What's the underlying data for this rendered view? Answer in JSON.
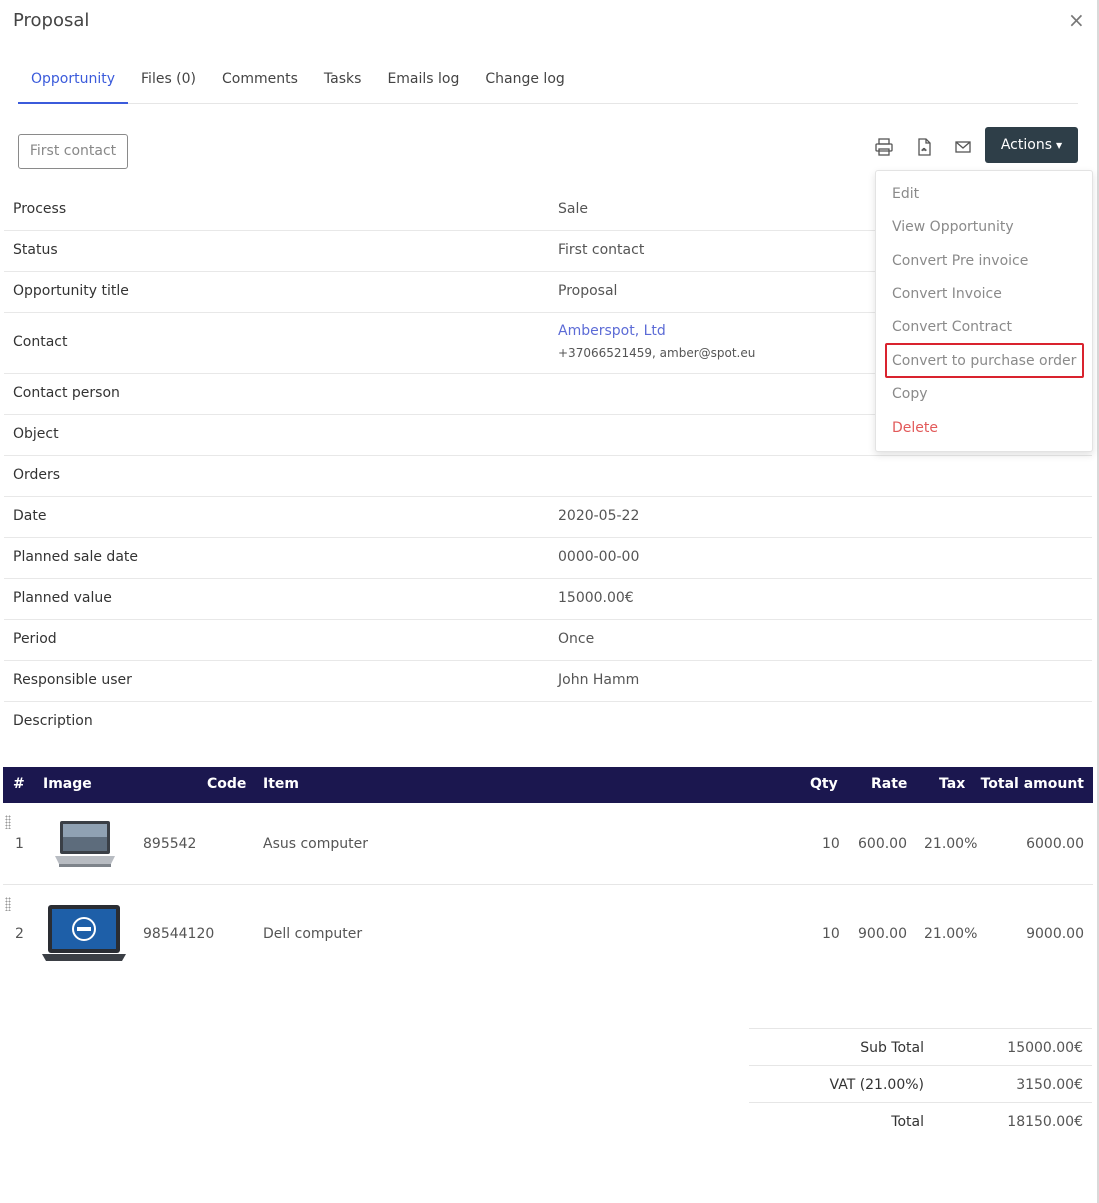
{
  "header": {
    "title": "Proposal",
    "close_symbol": "×"
  },
  "tabs": [
    {
      "label": "Opportunity"
    },
    {
      "label": "Files (0)"
    },
    {
      "label": "Comments"
    },
    {
      "label": "Tasks"
    },
    {
      "label": "Emails log"
    },
    {
      "label": "Change log"
    }
  ],
  "toolbar": {
    "status_label": "First contact",
    "actions_label": "Actions",
    "icons": [
      "print-icon",
      "pdf-icon",
      "email-icon"
    ]
  },
  "actions_menu": {
    "items": [
      {
        "label": "Edit"
      },
      {
        "label": "View Opportunity"
      },
      {
        "label": "Convert Pre invoice"
      },
      {
        "label": "Convert Invoice"
      },
      {
        "label": "Convert Contract"
      },
      {
        "label": "Convert to purchase order"
      },
      {
        "label": "Copy"
      },
      {
        "label": "Delete"
      }
    ]
  },
  "details": {
    "process": {
      "label": "Process",
      "value": "Sale"
    },
    "status": {
      "label": "Status",
      "value": "First contact"
    },
    "title": {
      "label": "Opportunity title",
      "value": "Proposal"
    },
    "contact": {
      "label": "Contact",
      "value": "Amberspot, Ltd",
      "sub": "+37066521459, amber@spot.eu"
    },
    "contact_person": {
      "label": "Contact person",
      "value": ""
    },
    "object": {
      "label": "Object",
      "value": ""
    },
    "orders": {
      "label": "Orders",
      "value": ""
    },
    "date": {
      "label": "Date",
      "value": "2020-05-22"
    },
    "planned_sale_date": {
      "label": "Planned sale date",
      "value": "0000-00-00"
    },
    "planned_value": {
      "label": "Planned value",
      "value": "15000.00€"
    },
    "period": {
      "label": "Period",
      "value": "Once"
    },
    "responsible_user": {
      "label": "Responsible user",
      "value": "John Hamm"
    },
    "description": {
      "label": "Description",
      "value": ""
    }
  },
  "items_table": {
    "headers": [
      "#",
      "Image",
      "Code",
      "Item",
      "Qty",
      "Rate",
      "Tax",
      "Total amount"
    ],
    "rows": [
      {
        "num": "1",
        "code": "895542",
        "item": "Asus computer",
        "qty": "10",
        "rate": "600.00",
        "tax": "21.00%",
        "total": "6000.00"
      },
      {
        "num": "2",
        "code": "98544120",
        "item": "Dell computer",
        "qty": "10",
        "rate": "900.00",
        "tax": "21.00%",
        "total": "9000.00"
      }
    ]
  },
  "totals": {
    "subtotal_label": "Sub Total",
    "subtotal_value": "15000.00€",
    "vat_label": "VAT (21.00%)",
    "vat_value": "3150.00€",
    "total_label": "Total",
    "total_value": "18150.00€"
  }
}
